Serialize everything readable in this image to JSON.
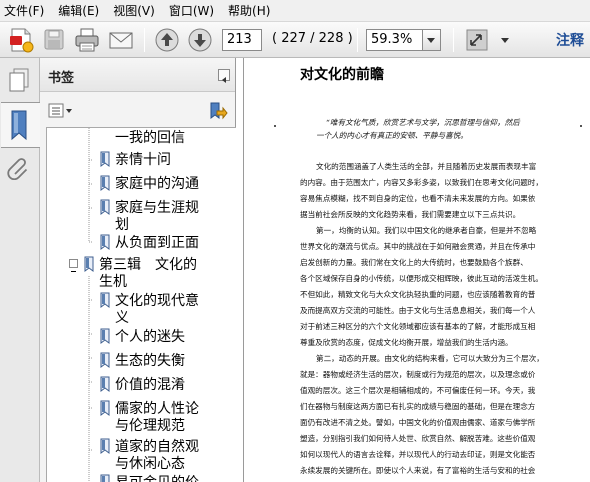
{
  "menu": [
    {
      "id": "file",
      "label": "文件(F)"
    },
    {
      "id": "edit",
      "label": "编辑(E)"
    },
    {
      "id": "view",
      "label": "视图(V)"
    },
    {
      "id": "window",
      "label": "窗口(W)"
    },
    {
      "id": "help",
      "label": "帮助(H)"
    }
  ],
  "toolbar": {
    "page_current": "213",
    "page_total": "( 227 / 228 )",
    "zoom": "59.3%",
    "comment_label": "注释"
  },
  "bookmarks": {
    "title": "书签",
    "items": [
      {
        "text": "一我的回信",
        "level": 2,
        "cont": true
      },
      {
        "text": "亲情十问",
        "level": 2
      },
      {
        "text": "家庭中的沟通",
        "level": 2
      },
      {
        "text": "家庭与生涯规",
        "text2": "划",
        "level": 2
      },
      {
        "text": "从负面到正面",
        "level": 2
      },
      {
        "text": "第三辑　文化的",
        "text2": "生机",
        "level": 1,
        "expanded": true
      },
      {
        "text": "文化的现代意",
        "text2": "义",
        "level": 2
      },
      {
        "text": "个人的迷失",
        "level": 2
      },
      {
        "text": "生态的失衡",
        "level": 2
      },
      {
        "text": "价值的混淆",
        "level": 2
      },
      {
        "text": "儒家的人性论",
        "text2": "与伦理规范",
        "level": 2
      },
      {
        "text": "道家的自然观",
        "text2": "与休闲心态",
        "level": 2
      },
      {
        "text": "易可金贝的价",
        "level": 2
      }
    ]
  },
  "document": {
    "title": "对文化的前瞻",
    "epigraph": [
      "“唯有文化气质，欣赏艺术与文学，沉思哲理与信仰，然后",
      "一个人的内心才有真正的安顿、平静与喜悦。"
    ],
    "paragraphs": [
      "文化的范围涵盖了人类生活的全部，并且随着历史发展而表现丰富",
      "的内容。由于范围太广，内容又多彩多姿，以致我们在思考文化问题时，",
      "容易焦点模糊，找不到自身的定位，也看不清未来发展的方向。如果依",
      "据当前社会所反映的文化趋势来看，我们需要建立以下三点共识。",
      "第一，均衡的认知。我们以中国文化的继承者自豪，但是并不忽略",
      "世界文化的潮流与优点。其中的挑战在于如何融会贯通，并且在传承中",
      "启发创新的力量。我们常在文化上的大传统时，也要鼓励各个族群、",
      "各个区域保存自身的小传统，以便形成交相辉映，彼此互动的活泼生机。",
      "不但如此，精致文化与大众文化执轻执重的问题，也应该随着教育的普",
      "及而提高双方交流的可能性。由于文化与生活息息相关，我们每一个人",
      "对于前述三种区分的六个文化领域都应该有基本的了解，才能形成互相",
      "尊重及欣赏的态度，促成文化均衡开展，增益我们的生活内涵。",
      "第二，动态的开展。由文化的结构来看，它可以大致分为三个层次，",
      "就是：器物或经济生活的层次，制度或行为规范的层次，以及理念或价",
      "值观的层次。这三个层次是相辅相成的，不可偏废任何一环。今天，我",
      "们在器物与制度这两方面已有扎实的成绩与稳固的基础，但是在理念方",
      "面仍有改进不清之处。譬如，中国文化的价值观由儒家、道家与佛学所",
      "塑造，分别指引我们如何待人处世、欣赏自然、解脱苦难。这些价值观",
      "如何以现代人的语言去诠释，并以现代人的行动去印证，则是文化能否",
      "永续发展的关键所在。即使以个人来说，有了富裕的生活与安和的社会"
    ]
  }
}
